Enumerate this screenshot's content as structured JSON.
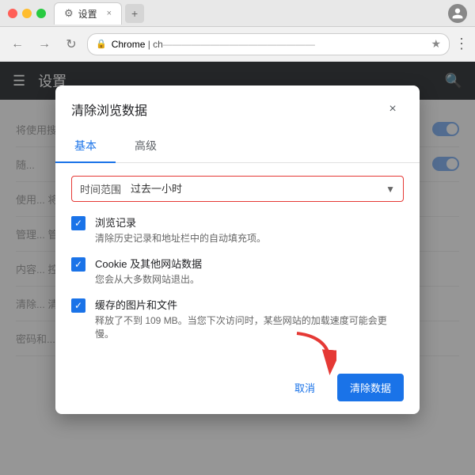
{
  "browser": {
    "titlebar": {
      "tab_title": "设置",
      "tab_close": "×",
      "new_tab": "+"
    },
    "addressbar": {
      "chrome_label": "Chrome",
      "address_prefix": "ch",
      "star_label": "★",
      "more_label": "⋮",
      "back": "←",
      "forward": "→",
      "refresh": "↻"
    }
  },
  "settings": {
    "header_title": "设置",
    "row1": "将使用搜索词补充查看资源提供生产途给 Google。",
    "row2": "随...",
    "row3": "使用... 将...",
    "row4": "管理... 管理...",
    "row5": "内容... 控制...",
    "row6": "清除... 清...",
    "row7": "密码和..."
  },
  "dialog": {
    "title": "清除浏览数据",
    "close_btn": "×",
    "tabs": [
      {
        "label": "基本",
        "active": true
      },
      {
        "label": "高级",
        "active": false
      }
    ],
    "time_range": {
      "label": "时间范围",
      "value": "过去一小时"
    },
    "checkboxes": [
      {
        "checked": true,
        "title": "浏览记录",
        "desc": "清除历史记录和地址栏中的自动填充项。"
      },
      {
        "checked": true,
        "title": "Cookie 及其他网站数据",
        "desc": "您会从大多数网站退出。"
      },
      {
        "checked": true,
        "title": "缓存的图片和文件",
        "desc": "释放了不到 109 MB。当您下次访问时，某些网站的加载速度可能会更慢。"
      }
    ],
    "cancel_btn": "取消",
    "clear_btn": "清除数据"
  }
}
